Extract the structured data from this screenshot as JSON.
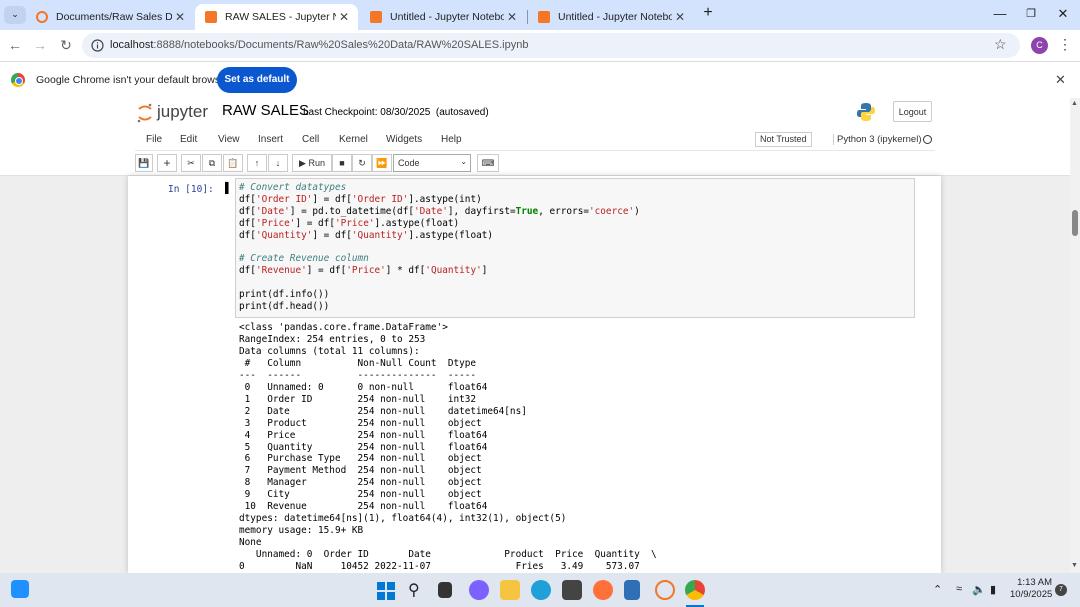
{
  "browser": {
    "tabs": [
      {
        "title": "Documents/Raw Sales Data/",
        "active": false,
        "icon": "jupyter-icon",
        "color": "#f37726"
      },
      {
        "title": "RAW SALES - Jupyter Notebook",
        "active": true,
        "icon": "notebook-icon",
        "color": "#f37726"
      },
      {
        "title": "Untitled - Jupyter Notebook",
        "active": false,
        "icon": "notebook-icon",
        "color": "#f37726"
      },
      {
        "title": "Untitled - Jupyter Notebook",
        "active": false,
        "icon": "notebook-icon",
        "color": "#f37726"
      }
    ],
    "new_tab": "+",
    "url_host": "localhost",
    "url_rest": ":8888/notebooks/Documents/Raw%20Sales%20Data/RAW%20SALES.ipynb",
    "profile_initial": "C",
    "infobar_text": "Google Chrome isn't your default browser",
    "set_default_label": "Set as default"
  },
  "jupyter": {
    "logo_text": "jupyter",
    "notebook_title": "RAW SALES",
    "checkpoint": "Last Checkpoint: 08/30/2025",
    "autosave": "(autosaved)",
    "logout_label": "Logout",
    "menu": [
      "File",
      "Edit",
      "View",
      "Insert",
      "Cell",
      "Kernel",
      "Widgets",
      "Help"
    ],
    "trust_status": "Not Trusted",
    "kernel_name": "Python 3 (ipykernel)",
    "run_label": "Run",
    "cell_type": "Code"
  },
  "cell": {
    "prompt": "In [10]:",
    "code_lines": [
      "# Convert datatypes",
      "df['Order ID'] = df['Order ID'].astype(int)",
      "df['Date'] = pd.to_datetime(df['Date'], dayfirst=True, errors='coerce')",
      "df['Price'] = df['Price'].astype(float)",
      "df['Quantity'] = df['Quantity'].astype(float)",
      "",
      "# Create Revenue column",
      "df['Revenue'] = df['Price'] * df['Quantity']",
      "",
      "print(df.info())",
      "print(df.head())"
    ],
    "output_lines": [
      "<class 'pandas.core.frame.DataFrame'>",
      "RangeIndex: 254 entries, 0 to 253",
      "Data columns (total 11 columns):",
      " #   Column          Non-Null Count  Dtype",
      "---  ------          --------------  -----",
      " 0   Unnamed: 0      0 non-null      float64",
      " 1   Order ID        254 non-null    int32",
      " 2   Date            254 non-null    datetime64[ns]",
      " 3   Product         254 non-null    object",
      " 4   Price           254 non-null    float64",
      " 5   Quantity        254 non-null    float64",
      " 6   Purchase Type   254 non-null    object",
      " 7   Payment Method  254 non-null    object",
      " 8   Manager         254 non-null    object",
      " 9   City            254 non-null    object",
      " 10  Revenue         254 non-null    float64",
      "dtypes: datetime64[ns](1), float64(4), int32(1), object(5)",
      "memory usage: 15.9+ KB",
      "None",
      "   Unnamed: 0  Order ID       Date             Product  Price  Quantity  \\",
      "0         NaN     10452 2022-11-07               Fries   3.49    573.07"
    ]
  },
  "taskbar": {
    "time": "1:13 AM",
    "date": "10/9/2025",
    "notification_count": "7"
  }
}
